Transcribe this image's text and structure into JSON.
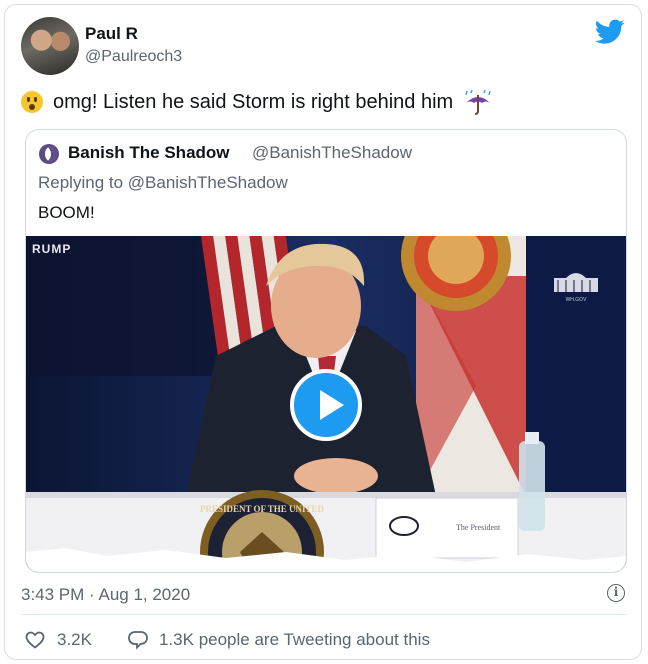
{
  "author": {
    "name": "Paul R",
    "handle": "@Paulreoch3"
  },
  "tweet": {
    "text": "omg! Listen he said Storm is right behind him",
    "lead_emoji": "hushed-face-emoji",
    "trail_emoji": "umbrella-with-rain-emoji"
  },
  "quoted": {
    "name": "Banish The Shadow",
    "handle": "@BanishTheShadow",
    "replying_prefix": "Replying to",
    "replying_handle": "@BanishTheShadow",
    "text": "BOOM!",
    "video": {
      "corner_label": "RUMP",
      "placard_text": "The President",
      "seal_text": "PRESIDENT OF THE UNITED"
    }
  },
  "meta": {
    "timestamp": "3:43 PM · Aug 1, 2020"
  },
  "actions": {
    "likes": "3.2K",
    "replies_text": "1.3K people are Tweeting about this"
  },
  "colors": {
    "accent": "#1d9bf0",
    "muted": "#5b6670",
    "text": "#0f1419"
  }
}
